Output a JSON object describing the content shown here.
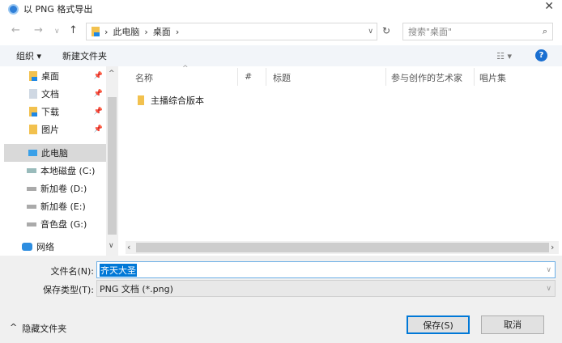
{
  "title": "以 PNG 格式导出",
  "address": {
    "crumbs": [
      "此电脑",
      "桌面"
    ],
    "search_placeholder": "搜索\"桌面\""
  },
  "toolbar": {
    "organize": "组织 ▾",
    "new_folder": "新建文件夹"
  },
  "nav": [
    {
      "label": "桌面",
      "pinned": true
    },
    {
      "label": "文档",
      "pinned": true
    },
    {
      "label": "下载",
      "pinned": true
    },
    {
      "label": "图片",
      "pinned": true
    },
    {
      "label": "此电脑"
    },
    {
      "label": "本地磁盘 (C:)"
    },
    {
      "label": "新加卷 (D:)"
    },
    {
      "label": "新加卷 (E:)"
    },
    {
      "label": "音色盘 (G:)"
    },
    {
      "label": "网络"
    }
  ],
  "columns": [
    "名称",
    "#",
    "标题",
    "参与创作的艺术家",
    "唱片集"
  ],
  "files": [
    {
      "name": "主播综合版本"
    }
  ],
  "form": {
    "filename_label": "文件名(N):",
    "filename": "齐天大圣",
    "type_label": "保存类型(T):",
    "type": "PNG 文档 (*.png)"
  },
  "hide_folders": "隐藏文件夹",
  "buttons": {
    "save": "保存(S)",
    "cancel": "取消"
  }
}
